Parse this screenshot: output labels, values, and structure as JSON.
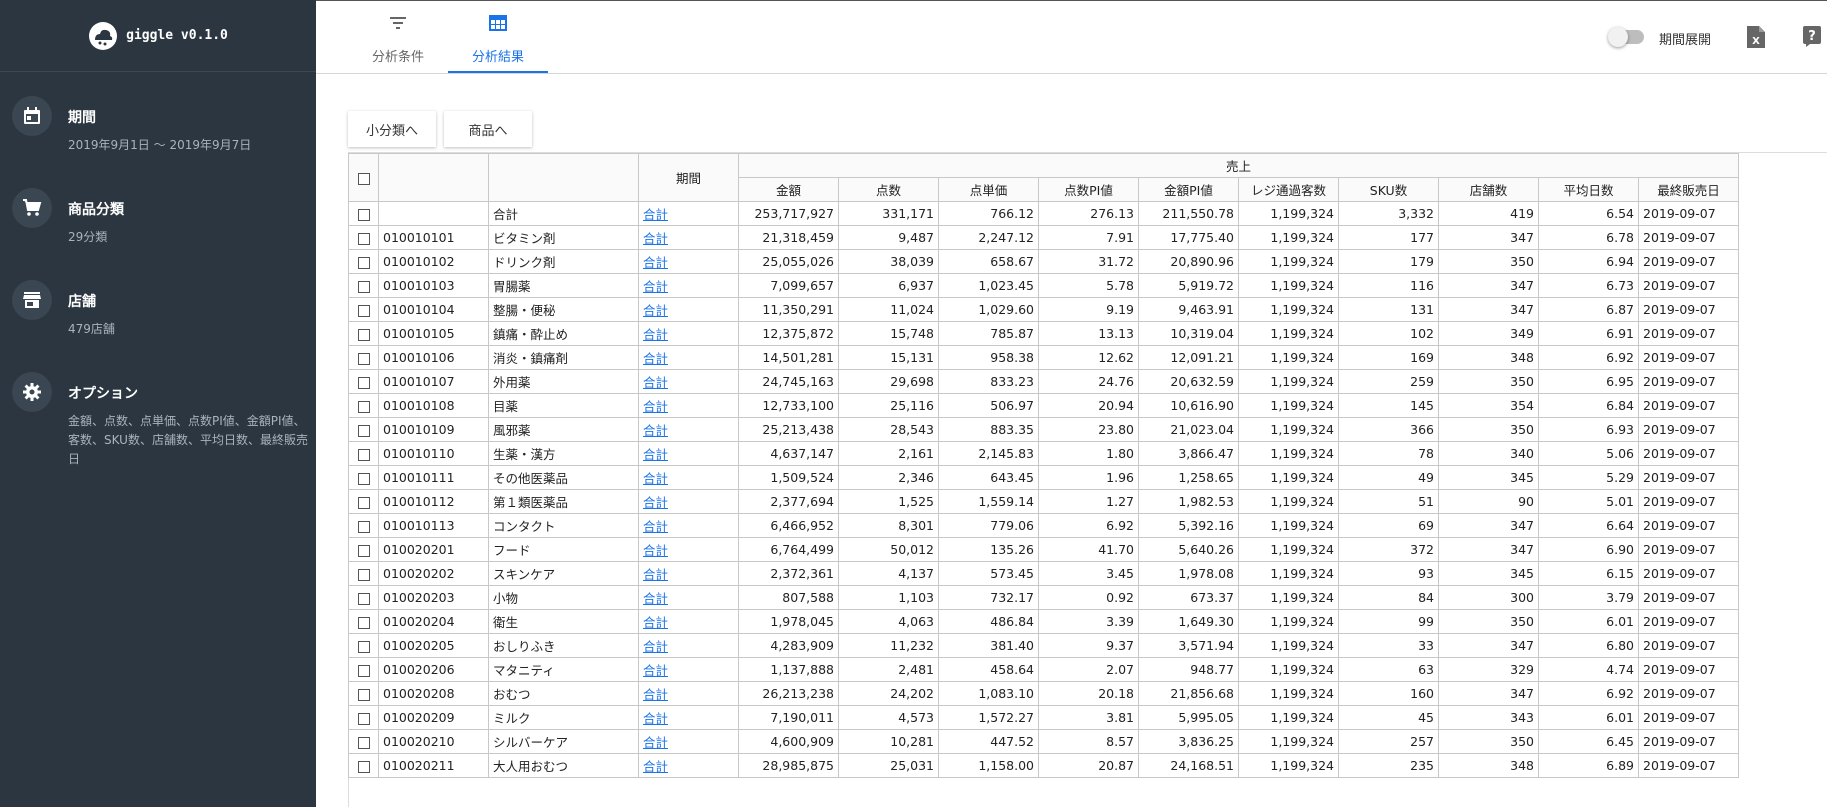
{
  "app": {
    "name": "giggle v0.1.0"
  },
  "sidebar": {
    "items": [
      {
        "title": "期間",
        "desc": "2019年9月1日 〜 2019年9月7日",
        "icon": "calendar-icon"
      },
      {
        "title": "商品分類",
        "desc": "29分類",
        "icon": "cart-icon"
      },
      {
        "title": "店舗",
        "desc": "479店舗",
        "icon": "store-icon"
      },
      {
        "title": "オプション",
        "desc": "金額、点数、点単価、点数PI値、金額PI値、客数、SKU数、店舗数、平均日数、最終販売日",
        "icon": "gear-icon"
      }
    ]
  },
  "tabs": [
    {
      "label": "分析条件",
      "icon": "filter-icon"
    },
    {
      "label": "分析結果",
      "icon": "table-icon"
    }
  ],
  "toolbar": {
    "toggle_label": "期間展開",
    "toggle_on": false
  },
  "actions": {
    "subcategory_button": "小分類へ",
    "product_button": "商品へ"
  },
  "table": {
    "header_period": "期間",
    "header_sales": "売上",
    "columns": [
      "金額",
      "点数",
      "点単価",
      "点数PI値",
      "金額PI値",
      "レジ通過客数",
      "SKU数",
      "店舗数",
      "平均日数",
      "最終販売日"
    ],
    "rows": [
      {
        "code": "",
        "name": "合計",
        "period": "合計",
        "values": [
          "253,717,927",
          "331,171",
          "766.12",
          "276.13",
          "211,550.78",
          "1,199,324",
          "3,332",
          "419",
          "6.54",
          "2019-09-07"
        ]
      },
      {
        "code": "010010101",
        "name": "ビタミン剤",
        "period": "合計",
        "values": [
          "21,318,459",
          "9,487",
          "2,247.12",
          "7.91",
          "17,775.40",
          "1,199,324",
          "177",
          "347",
          "6.78",
          "2019-09-07"
        ]
      },
      {
        "code": "010010102",
        "name": "ドリンク剤",
        "period": "合計",
        "values": [
          "25,055,026",
          "38,039",
          "658.67",
          "31.72",
          "20,890.96",
          "1,199,324",
          "179",
          "350",
          "6.94",
          "2019-09-07"
        ]
      },
      {
        "code": "010010103",
        "name": "胃腸薬",
        "period": "合計",
        "values": [
          "7,099,657",
          "6,937",
          "1,023.45",
          "5.78",
          "5,919.72",
          "1,199,324",
          "116",
          "347",
          "6.73",
          "2019-09-07"
        ]
      },
      {
        "code": "010010104",
        "name": "整腸・便秘",
        "period": "合計",
        "values": [
          "11,350,291",
          "11,024",
          "1,029.60",
          "9.19",
          "9,463.91",
          "1,199,324",
          "131",
          "347",
          "6.87",
          "2019-09-07"
        ]
      },
      {
        "code": "010010105",
        "name": "鎮痛・酔止め",
        "period": "合計",
        "values": [
          "12,375,872",
          "15,748",
          "785.87",
          "13.13",
          "10,319.04",
          "1,199,324",
          "102",
          "349",
          "6.91",
          "2019-09-07"
        ]
      },
      {
        "code": "010010106",
        "name": "消炎・鎮痛剤",
        "period": "合計",
        "values": [
          "14,501,281",
          "15,131",
          "958.38",
          "12.62",
          "12,091.21",
          "1,199,324",
          "169",
          "348",
          "6.92",
          "2019-09-07"
        ]
      },
      {
        "code": "010010107",
        "name": "外用薬",
        "period": "合計",
        "values": [
          "24,745,163",
          "29,698",
          "833.23",
          "24.76",
          "20,632.59",
          "1,199,324",
          "259",
          "350",
          "6.95",
          "2019-09-07"
        ]
      },
      {
        "code": "010010108",
        "name": "目薬",
        "period": "合計",
        "values": [
          "12,733,100",
          "25,116",
          "506.97",
          "20.94",
          "10,616.90",
          "1,199,324",
          "145",
          "354",
          "6.84",
          "2019-09-07"
        ]
      },
      {
        "code": "010010109",
        "name": "風邪薬",
        "period": "合計",
        "values": [
          "25,213,438",
          "28,543",
          "883.35",
          "23.80",
          "21,023.04",
          "1,199,324",
          "366",
          "350",
          "6.93",
          "2019-09-07"
        ]
      },
      {
        "code": "010010110",
        "name": "生薬・漢方",
        "period": "合計",
        "values": [
          "4,637,147",
          "2,161",
          "2,145.83",
          "1.80",
          "3,866.47",
          "1,199,324",
          "78",
          "340",
          "5.06",
          "2019-09-07"
        ]
      },
      {
        "code": "010010111",
        "name": "その他医薬品",
        "period": "合計",
        "values": [
          "1,509,524",
          "2,346",
          "643.45",
          "1.96",
          "1,258.65",
          "1,199,324",
          "49",
          "345",
          "5.29",
          "2019-09-07"
        ]
      },
      {
        "code": "010010112",
        "name": "第１類医薬品",
        "period": "合計",
        "values": [
          "2,377,694",
          "1,525",
          "1,559.14",
          "1.27",
          "1,982.53",
          "1,199,324",
          "51",
          "90",
          "5.01",
          "2019-09-07"
        ]
      },
      {
        "code": "010010113",
        "name": "コンタクト",
        "period": "合計",
        "values": [
          "6,466,952",
          "8,301",
          "779.06",
          "6.92",
          "5,392.16",
          "1,199,324",
          "69",
          "347",
          "6.64",
          "2019-09-07"
        ]
      },
      {
        "code": "010020201",
        "name": "フード",
        "period": "合計",
        "values": [
          "6,764,499",
          "50,012",
          "135.26",
          "41.70",
          "5,640.26",
          "1,199,324",
          "372",
          "347",
          "6.90",
          "2019-09-07"
        ]
      },
      {
        "code": "010020202",
        "name": "スキンケア",
        "period": "合計",
        "values": [
          "2,372,361",
          "4,137",
          "573.45",
          "3.45",
          "1,978.08",
          "1,199,324",
          "93",
          "345",
          "6.15",
          "2019-09-07"
        ]
      },
      {
        "code": "010020203",
        "name": "小物",
        "period": "合計",
        "values": [
          "807,588",
          "1,103",
          "732.17",
          "0.92",
          "673.37",
          "1,199,324",
          "84",
          "300",
          "3.79",
          "2019-09-07"
        ]
      },
      {
        "code": "010020204",
        "name": "衛生",
        "period": "合計",
        "values": [
          "1,978,045",
          "4,063",
          "486.84",
          "3.39",
          "1,649.30",
          "1,199,324",
          "99",
          "350",
          "6.01",
          "2019-09-07"
        ]
      },
      {
        "code": "010020205",
        "name": "おしりふき",
        "period": "合計",
        "values": [
          "4,283,909",
          "11,232",
          "381.40",
          "9.37",
          "3,571.94",
          "1,199,324",
          "33",
          "347",
          "6.80",
          "2019-09-07"
        ]
      },
      {
        "code": "010020206",
        "name": "マタニティ",
        "period": "合計",
        "values": [
          "1,137,888",
          "2,481",
          "458.64",
          "2.07",
          "948.77",
          "1,199,324",
          "63",
          "329",
          "4.74",
          "2019-09-07"
        ]
      },
      {
        "code": "010020208",
        "name": "おむつ",
        "period": "合計",
        "values": [
          "26,213,238",
          "24,202",
          "1,083.10",
          "20.18",
          "21,856.68",
          "1,199,324",
          "160",
          "347",
          "6.92",
          "2019-09-07"
        ]
      },
      {
        "code": "010020209",
        "name": "ミルク",
        "period": "合計",
        "values": [
          "7,190,011",
          "4,573",
          "1,572.27",
          "3.81",
          "5,995.05",
          "1,199,324",
          "45",
          "343",
          "6.01",
          "2019-09-07"
        ]
      },
      {
        "code": "010020210",
        "name": "シルバーケア",
        "period": "合計",
        "values": [
          "4,600,909",
          "10,281",
          "447.52",
          "8.57",
          "3,836.25",
          "1,199,324",
          "257",
          "350",
          "6.45",
          "2019-09-07"
        ]
      },
      {
        "code": "010020211",
        "name": "大人用おむつ",
        "period": "合計",
        "values": [
          "28,985,875",
          "25,031",
          "1,158.00",
          "20.87",
          "24,168.51",
          "1,199,324",
          "235",
          "348",
          "6.89",
          "2019-09-07"
        ]
      }
    ]
  },
  "colors": {
    "sidebar_bg": "#2b3640",
    "accent": "#1a73e8"
  }
}
